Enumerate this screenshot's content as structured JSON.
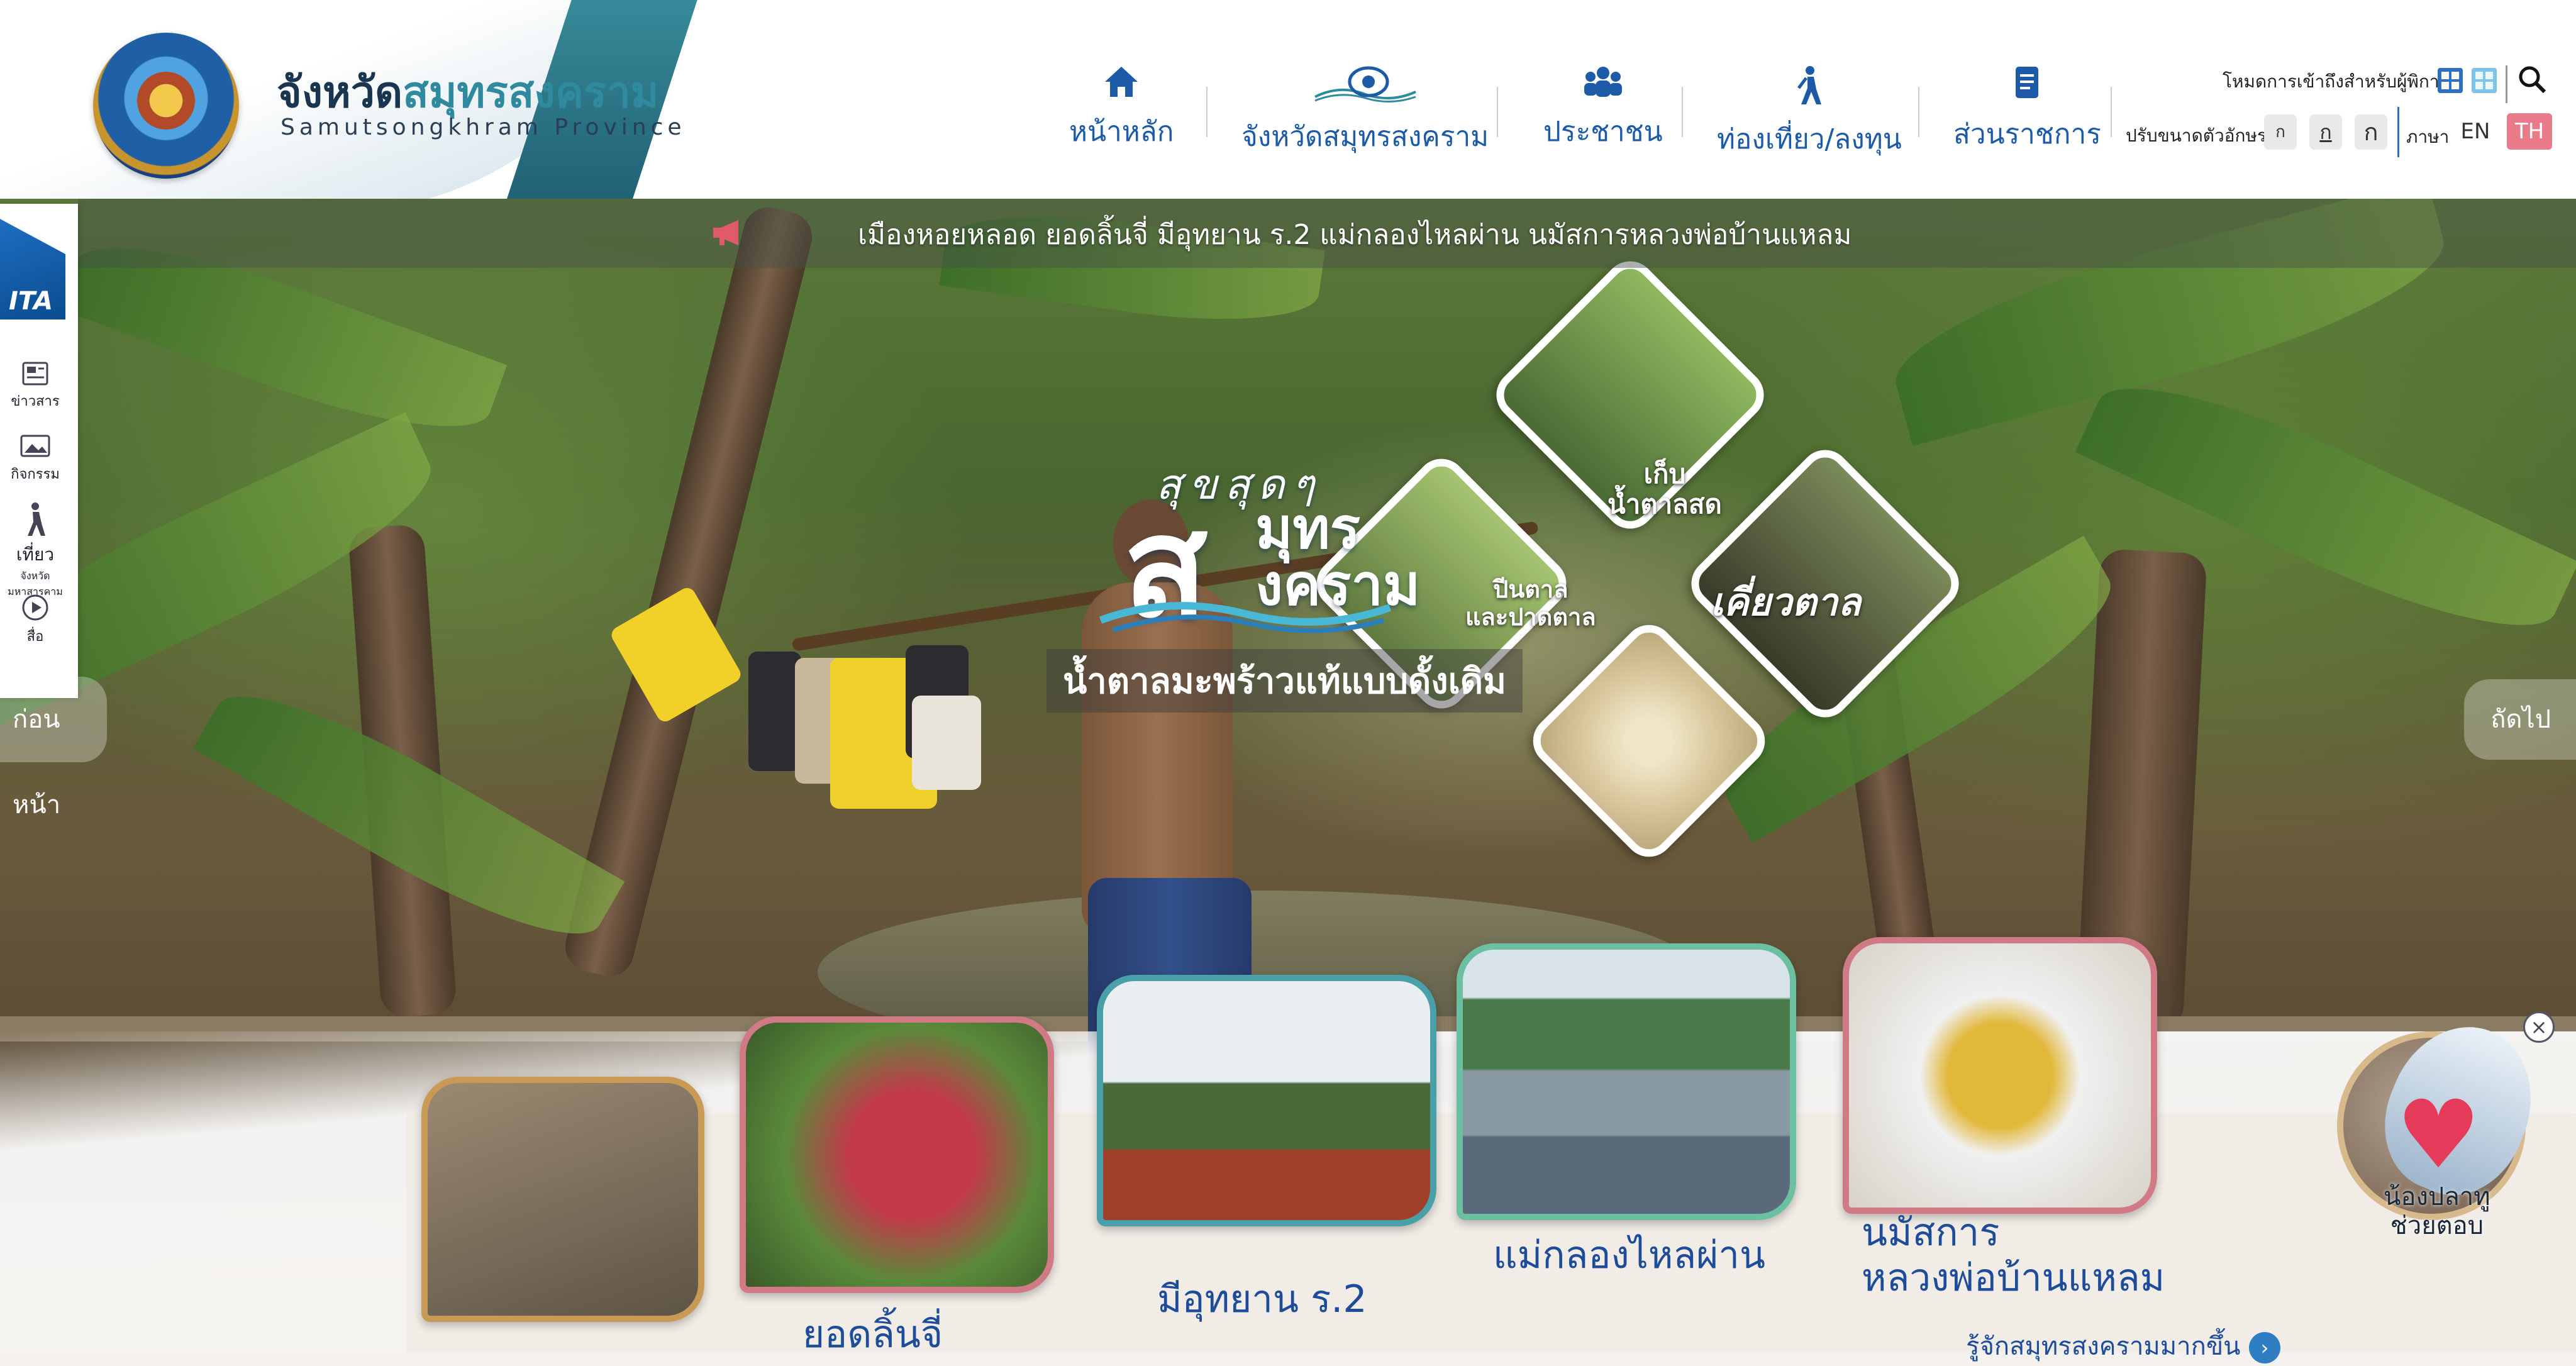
{
  "header": {
    "site_title_th_main": "จังหวัด",
    "site_title_th_accent": "สมุทรสงคราม",
    "site_title_en": "Samutsongkhram Province",
    "nav": [
      {
        "label": "หน้าหลัก",
        "icon": "home-icon"
      },
      {
        "label": "จังหวัดสมุทรสงคราม",
        "icon": "province-emblem-icon"
      },
      {
        "label": "ประชาชน",
        "icon": "people-icon"
      },
      {
        "label": "ท่องเที่ยว/ลงทุน",
        "icon": "walking-person-icon"
      },
      {
        "label": "ส่วนราชการ",
        "icon": "document-icon"
      }
    ],
    "accessibility_label": "โหมดการเข้าถึงสำหรับผู้พิการ",
    "font_size_label": "ปรับขนาดตัวอักษร",
    "font_buttons": [
      "ก",
      "ก",
      "ก"
    ],
    "language_label": "ภาษา",
    "languages": [
      "EN",
      "TH"
    ],
    "active_language": "TH",
    "accent_color": "#2f8aa0",
    "nav_color": "#1d5aa8"
  },
  "marquee": {
    "text": "เมืองหอยหลอด ยอดลิ้นจี่ มีอุทยาน ร.2 แม่กลองไหลผ่าน นมัสการหลวงพ่อบ้านแหลม",
    "icon": "megaphone-icon"
  },
  "side_toolbar": {
    "badge": "ITA",
    "items": [
      {
        "label": "ข่าวสาร",
        "icon": "news-icon"
      },
      {
        "label": "กิจกรรม",
        "icon": "activity-icon"
      },
      {
        "label": "เที่ยว",
        "sublabel": "จังหวัดมหาสารคาม",
        "icon": "travel-icon"
      },
      {
        "label": "สื่อ",
        "icon": "play-icon"
      }
    ]
  },
  "slider": {
    "prev_label": "ก่อนหน้า",
    "next_label": "ถัดไป"
  },
  "hero": {
    "headline_top": "สุขสุดๆ",
    "headline_big": "ส",
    "headline_big2_line1": "มุทร",
    "headline_big2_line2": "งคราม",
    "subtitle": "น้ำตาลมะพร้าวแท้แบบดั้งเดิม",
    "diamond_labels": [
      "เก็บ\nน้ำตาลสด",
      "ปีนตาล\nและปาดตาล",
      "เคี่ยวตาล"
    ]
  },
  "cards": [
    {
      "label": "",
      "name": "razor-clam"
    },
    {
      "label": "ยอดลิ้นจี่",
      "name": "lychee"
    },
    {
      "label": "มีอุทยาน ร.2",
      "name": "rama2-park"
    },
    {
      "label": "แม่กลองไหลผ่าน",
      "name": "maeklong-river"
    },
    {
      "label_line1": "นมัสการ",
      "label_line2": "หลวงพ่อบ้านแหลม",
      "name": "luang-pho-ban-laem"
    }
  ],
  "know_more": "รู้จักสมุทรสงครามมากขึ้น",
  "chatbot": {
    "label_line1": "น้องปลาทู",
    "label_line2": "ช่วยตอบ",
    "close": "×"
  }
}
